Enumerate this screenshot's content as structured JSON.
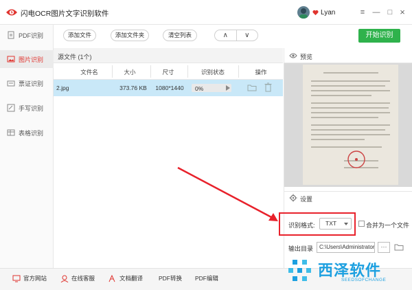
{
  "app": {
    "title": "闪电OCR图片文字识别软件",
    "user_name": "Lyan",
    "window_controls": [
      "≡",
      "—",
      "□",
      "×"
    ]
  },
  "sidebar": {
    "items": [
      {
        "label": "PDF识别",
        "icon": "pdf-icon"
      },
      {
        "label": "图片识别",
        "icon": "image-icon",
        "active": true
      },
      {
        "label": "票证识别",
        "icon": "ticket-icon"
      },
      {
        "label": "手写识别",
        "icon": "handwriting-icon"
      },
      {
        "label": "表格识别",
        "icon": "table-icon"
      }
    ]
  },
  "toolbar": {
    "add_file": "添加文件",
    "add_folder": "添加文件夹",
    "clear_list": "清空列表",
    "up": "∧",
    "down": "∨",
    "start": "开始识别"
  },
  "file_list": {
    "title": "源文件 (1个)",
    "columns": [
      "文件名",
      "大小",
      "尺寸",
      "识别状态",
      "操作"
    ],
    "rows": [
      {
        "name": "2.jpg",
        "size": "373.76 KB",
        "dimensions": "1080*1440",
        "status": "0%",
        "progress": 0
      }
    ]
  },
  "preview": {
    "label": "预览"
  },
  "settings": {
    "label": "设置",
    "format_label": "识别格式:",
    "format_value": "TXT",
    "merge_label": "合并为一个文件",
    "merge_checked": false,
    "outdir_label": "输出目录",
    "outdir_value": "C:\\Users\\Administrator\\",
    "more": "···"
  },
  "bottom": {
    "items": [
      {
        "label": "官方网站",
        "icon": "monitor-icon"
      },
      {
        "label": "在线客服",
        "icon": "support-icon"
      },
      {
        "label": "文档翻译",
        "icon": "translate-icon"
      },
      {
        "label": "PDF转换",
        "icon": ""
      },
      {
        "label": "PDF编辑",
        "icon": ""
      }
    ]
  },
  "watermark": {
    "brand": "西泽软件",
    "sub": "SEEDSOFCHANGE"
  },
  "colors": {
    "accent_red": "#e0342f",
    "start_green": "#2fb24c",
    "row_selected": "#c9e8f8",
    "highlight": "#e8212b",
    "brand_blue": "#1da0e0"
  }
}
